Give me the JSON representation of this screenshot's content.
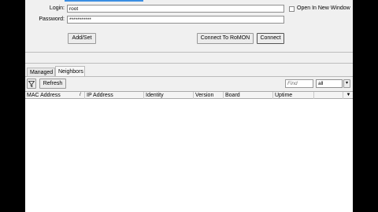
{
  "login": {
    "label": "Login:",
    "value": "root"
  },
  "password": {
    "label": "Password:",
    "value": "***********"
  },
  "open_new_window": {
    "label": "Open In New Window"
  },
  "buttons": {
    "add_set": "Add/Set",
    "connect_remon": "Connect To RoMON",
    "connect": "Connect"
  },
  "tabs": [
    {
      "label": "Managed"
    },
    {
      "label": "Neighbors"
    }
  ],
  "toolbar": {
    "refresh": "Refresh",
    "find_placeholder": "Find",
    "filter_value": "all"
  },
  "table": {
    "columns": [
      "MAC Address",
      "IP Address",
      "Identity",
      "Version",
      "Board",
      "Uptime"
    ]
  }
}
